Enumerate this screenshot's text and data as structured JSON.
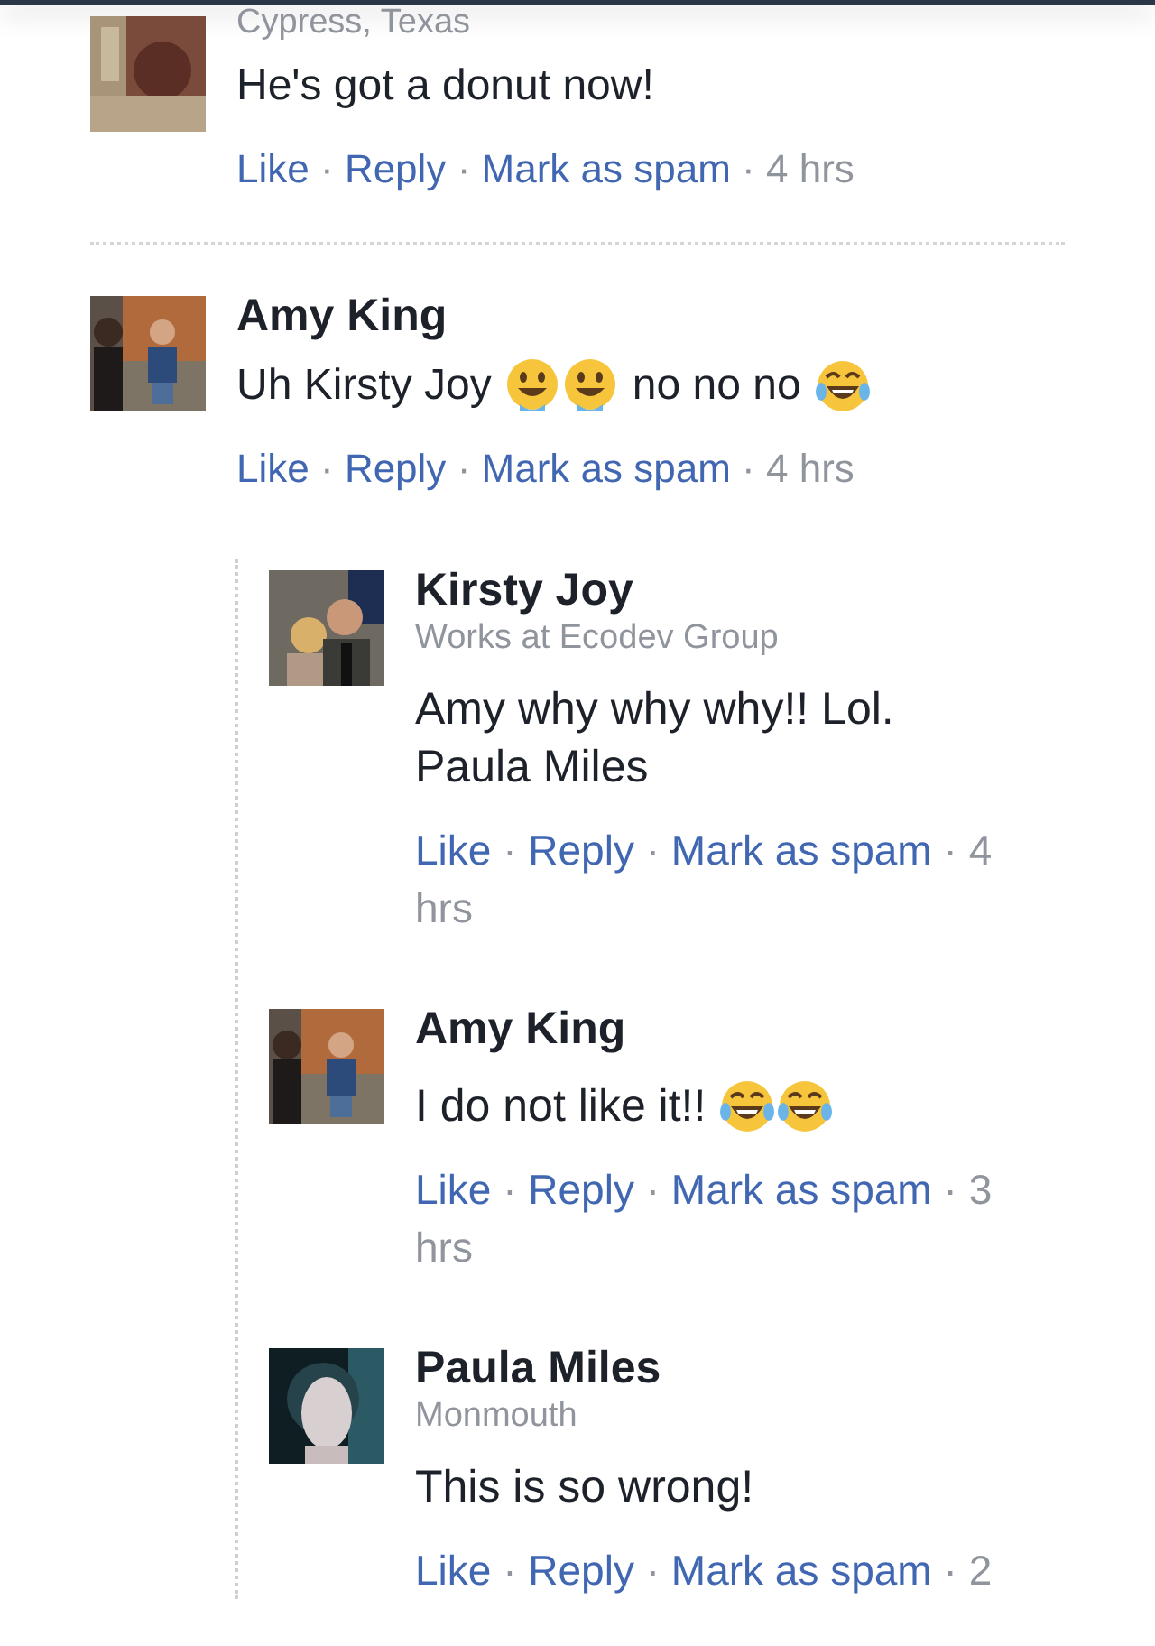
{
  "comments": [
    {
      "location": "Cypress, Texas",
      "avatar": {
        "kind": "picture"
      },
      "body": [
        {
          "kind": "text",
          "text": "He's got a donut now!"
        }
      ],
      "meta": [
        {
          "kind": "link",
          "text": "Like"
        },
        {
          "kind": "sep",
          "text": "·"
        },
        {
          "kind": "link",
          "text": "Reply"
        },
        {
          "kind": "sep",
          "text": "·"
        },
        {
          "kind": "link",
          "text": "Mark as spam"
        },
        {
          "kind": "sep",
          "text": "·"
        },
        {
          "kind": "time",
          "text": "4 hrs"
        }
      ]
    },
    {
      "author": "Amy King",
      "avatar": {
        "kind": "picture"
      },
      "body": [
        {
          "kind": "text",
          "text": "Uh Kirsty Joy"
        },
        {
          "kind": "drool"
        },
        {
          "kind": "drool"
        },
        {
          "kind": "text",
          "text": "no no no"
        },
        {
          "kind": "joy"
        }
      ],
      "meta": [
        {
          "kind": "link",
          "text": "Like"
        },
        {
          "kind": "sep",
          "text": "·"
        },
        {
          "kind": "link",
          "text": "Reply"
        },
        {
          "kind": "sep",
          "text": "·"
        },
        {
          "kind": "link",
          "text": "Mark as spam"
        },
        {
          "kind": "sep",
          "text": "·"
        },
        {
          "kind": "time",
          "text": "4 hrs"
        }
      ],
      "replies": [
        {
          "author": "Kirsty Joy",
          "location": "Works at Ecodev Group",
          "avatar": {
            "kind": "picture"
          },
          "body": [
            {
              "kind": "text",
              "text": "Amy why why why!! Lol. Paula Miles"
            }
          ],
          "meta": [
            {
              "kind": "link",
              "text": "Like"
            },
            {
              "kind": "sep",
              "text": "·"
            },
            {
              "kind": "link",
              "text": "Reply"
            },
            {
              "kind": "sep",
              "text": "·"
            },
            {
              "kind": "link",
              "text": "Mark as spam"
            },
            {
              "kind": "sep",
              "text": "·"
            },
            {
              "kind": "time",
              "text": "4"
            },
            {
              "kind": "time",
              "text": "hrs"
            }
          ]
        },
        {
          "author": "Amy King",
          "avatar": {
            "kind": "picture"
          },
          "body": [
            {
              "kind": "text",
              "text": "I do not like it!!"
            },
            {
              "kind": "joy"
            },
            {
              "kind": "joy"
            }
          ],
          "meta": [
            {
              "kind": "link",
              "text": "Like"
            },
            {
              "kind": "sep",
              "text": "·"
            },
            {
              "kind": "link",
              "text": "Reply"
            },
            {
              "kind": "sep",
              "text": "·"
            },
            {
              "kind": "link",
              "text": "Mark as spam"
            },
            {
              "kind": "sep",
              "text": "·"
            },
            {
              "kind": "time",
              "text": "3"
            },
            {
              "kind": "time",
              "text": "hrs"
            }
          ]
        },
        {
          "author": "Paula Miles",
          "location": "Monmouth",
          "avatar": {
            "kind": "picture"
          },
          "body": [
            {
              "kind": "text",
              "text": "This is so wrong!"
            }
          ],
          "meta": [
            {
              "kind": "link",
              "text": "Like"
            },
            {
              "kind": "sep",
              "text": "·"
            },
            {
              "kind": "link",
              "text": "Reply"
            },
            {
              "kind": "sep",
              "text": "·"
            },
            {
              "kind": "link",
              "text": "Mark as spam"
            },
            {
              "kind": "sep",
              "text": "·"
            },
            {
              "kind": "time",
              "text": "2"
            }
          ]
        }
      ]
    }
  ]
}
